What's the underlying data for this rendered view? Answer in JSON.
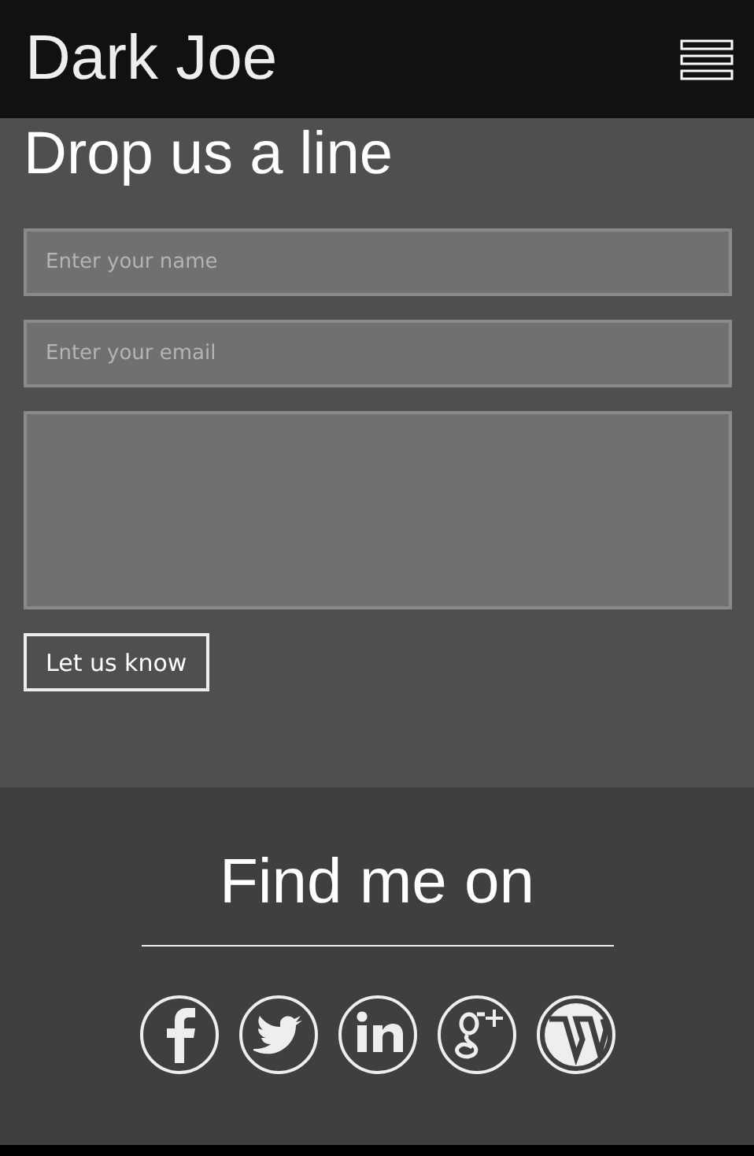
{
  "header": {
    "title": "Dark Joe"
  },
  "contact": {
    "heading": "Drop us a line",
    "name_field": {
      "placeholder": "Enter your name"
    },
    "email_field": {
      "placeholder": "Enter your email"
    },
    "submit": "Let us know"
  },
  "social": {
    "heading": "Find me on"
  }
}
